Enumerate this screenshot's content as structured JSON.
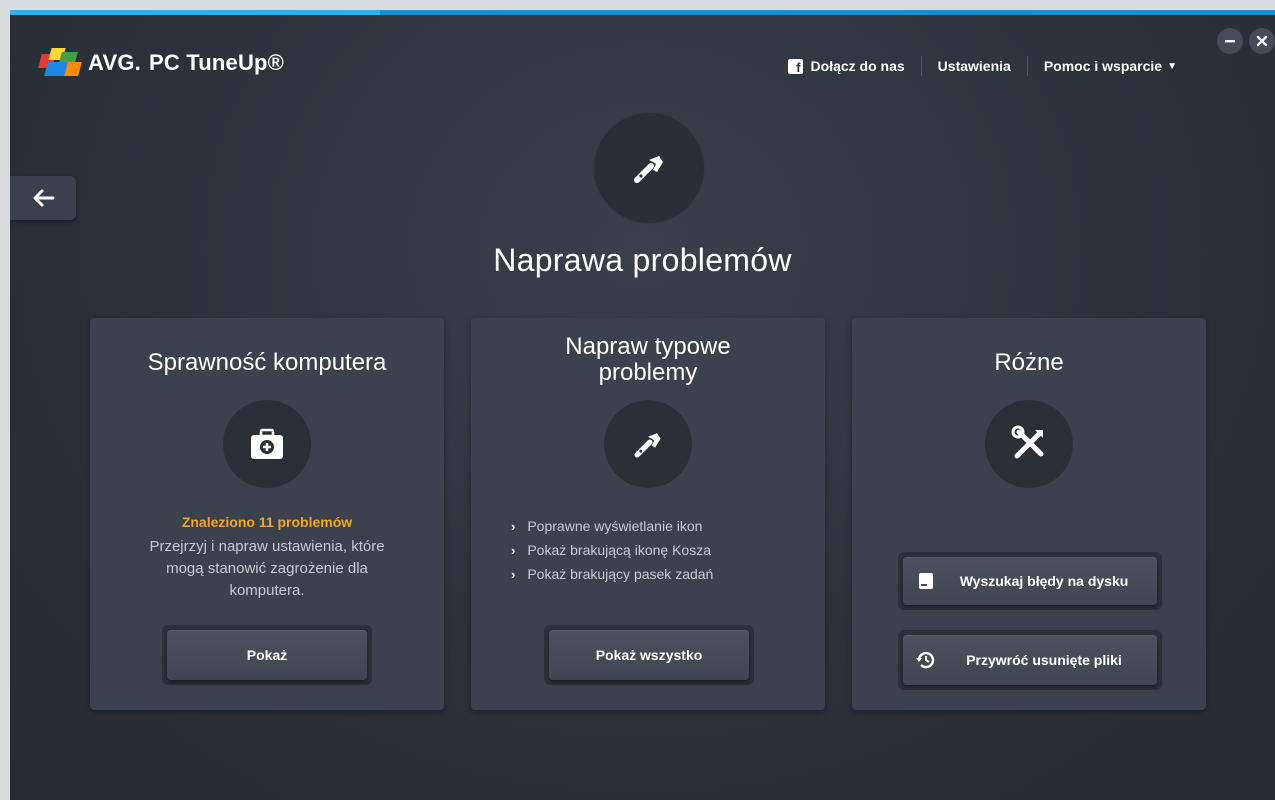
{
  "app": {
    "brand_avg": "AVG.",
    "brand_product": "PC TuneUp®"
  },
  "nav": {
    "facebook_label": "Dołącz do nas",
    "settings_label": "Ustawienia",
    "help_label": "Pomoc i wsparcie"
  },
  "page": {
    "title": "Naprawa problemów"
  },
  "cards": {
    "health": {
      "title": "Sprawność komputera",
      "warning": "Znaleziono 11 problemów",
      "description": "Przejrzyj i napraw ustawienia, które mogą stanowić zagrożenie dla komputera.",
      "button": "Pokaż"
    },
    "common": {
      "title": "Napraw typowe problemy",
      "bullets": [
        "Poprawne wyświetlanie ikon",
        "Pokaż brakującą ikonę Kosza",
        "Pokaż brakujący pasek zadań"
      ],
      "button": "Pokaż wszystko"
    },
    "misc": {
      "title": "Różne",
      "disk_button": "Wyszukaj błędy na dysku",
      "restore_button": "Przywróć usunięte pliki"
    }
  },
  "colors": {
    "accent": "#2fb0e8",
    "warning": "#f5a623",
    "card_bg": "#3c424d"
  }
}
